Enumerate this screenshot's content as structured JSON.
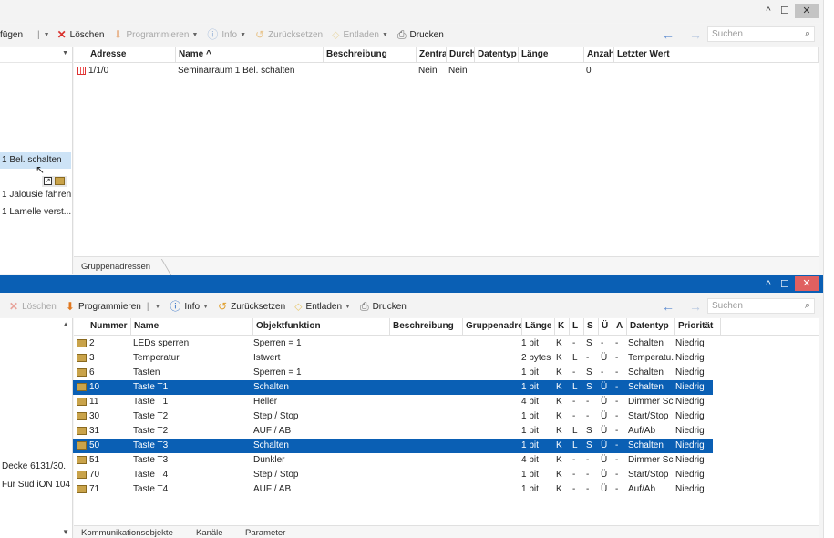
{
  "top": {
    "window_buttons": {
      "minimize": "^",
      "maximize": "☐",
      "close": "✕"
    },
    "toolbar": {
      "insert_label": "fügen",
      "delete_label": "Löschen",
      "program_label": "Programmieren",
      "info_label": "Info",
      "reset_label": "Zurücksetzen",
      "unload_label": "Entladen",
      "print_label": "Drucken",
      "search_placeholder": "Suchen"
    },
    "tree": [
      {
        "label": "1 Bel. schalten",
        "selected": true
      },
      {
        "label": "1 Jalousie fahren",
        "selected": false
      },
      {
        "label": "1 Lamelle verst...",
        "selected": false
      }
    ],
    "columns": [
      "Adresse",
      "Name ^",
      "Beschreibung",
      "Zentra",
      "Durch",
      "Datentyp",
      "Länge",
      "Anzah",
      "Letzter Wert"
    ],
    "rows": [
      {
        "adresse": "1/1/0",
        "name": "Seminarraum 1 Bel. schalten",
        "beschreibung": "",
        "zentral": "Nein",
        "durch": "Nein",
        "datentyp": "",
        "laenge": "",
        "anzahl": "0",
        "letzter": ""
      }
    ],
    "tab": "Gruppenadressen"
  },
  "bottom": {
    "window_buttons": {
      "minimize": "^",
      "maximize": "☐",
      "close": "✕"
    },
    "toolbar": {
      "delete_label": "Löschen",
      "program_label": "Programmieren",
      "info_label": "Info",
      "reset_label": "Zurücksetzen",
      "unload_label": "Entladen",
      "print_label": "Drucken",
      "search_placeholder": "Suchen"
    },
    "tree": [
      {
        "label": "Decke 6131/30."
      },
      {
        "label": "Für Süd iON 104"
      }
    ],
    "columns": [
      "Nummer",
      "Name",
      "Objektfunktion",
      "Beschreibung",
      "Gruppenadres",
      "Länge",
      "K",
      "L",
      "S",
      "Ü",
      "A",
      "Datentyp",
      "Priorität"
    ],
    "rows": [
      {
        "nr": "2",
        "name": "LEDs sperren",
        "fn": "Sperren = 1",
        "len": "1 bit",
        "k": "K",
        "l": "-",
        "s": "S",
        "u": "-",
        "a": "-",
        "typ": "Schalten",
        "prio": "Niedrig",
        "sel": false
      },
      {
        "nr": "3",
        "name": "Temperatur",
        "fn": "Istwert",
        "len": "2 bytes",
        "k": "K",
        "l": "L",
        "s": "-",
        "u": "Ü",
        "a": "-",
        "typ": "Temperatu...",
        "prio": "Niedrig",
        "sel": false
      },
      {
        "nr": "6",
        "name": "Tasten",
        "fn": "Sperren = 1",
        "len": "1 bit",
        "k": "K",
        "l": "-",
        "s": "S",
        "u": "-",
        "a": "-",
        "typ": "Schalten",
        "prio": "Niedrig",
        "sel": false
      },
      {
        "nr": "10",
        "name": "Taste T1",
        "fn": "Schalten",
        "len": "1 bit",
        "k": "K",
        "l": "L",
        "s": "S",
        "u": "Ü",
        "a": "-",
        "typ": "Schalten",
        "prio": "Niedrig",
        "sel": true
      },
      {
        "nr": "11",
        "name": "Taste T1",
        "fn": "Heller",
        "len": "4 bit",
        "k": "K",
        "l": "-",
        "s": "-",
        "u": "Ü",
        "a": "-",
        "typ": "Dimmer Sc...",
        "prio": "Niedrig",
        "sel": false
      },
      {
        "nr": "30",
        "name": "Taste T2",
        "fn": "Step / Stop",
        "len": "1 bit",
        "k": "K",
        "l": "-",
        "s": "-",
        "u": "Ü",
        "a": "-",
        "typ": "Start/Stop",
        "prio": "Niedrig",
        "sel": false
      },
      {
        "nr": "31",
        "name": "Taste T2",
        "fn": "AUF / AB",
        "len": "1 bit",
        "k": "K",
        "l": "L",
        "s": "S",
        "u": "Ü",
        "a": "-",
        "typ": "Auf/Ab",
        "prio": "Niedrig",
        "sel": false
      },
      {
        "nr": "50",
        "name": "Taste T3",
        "fn": "Schalten",
        "len": "1 bit",
        "k": "K",
        "l": "L",
        "s": "S",
        "u": "Ü",
        "a": "-",
        "typ": "Schalten",
        "prio": "Niedrig",
        "sel": true
      },
      {
        "nr": "51",
        "name": "Taste T3",
        "fn": "Dunkler",
        "len": "4 bit",
        "k": "K",
        "l": "-",
        "s": "-",
        "u": "Ü",
        "a": "-",
        "typ": "Dimmer Sc...",
        "prio": "Niedrig",
        "sel": false
      },
      {
        "nr": "70",
        "name": "Taste T4",
        "fn": "Step / Stop",
        "len": "1 bit",
        "k": "K",
        "l": "-",
        "s": "-",
        "u": "Ü",
        "a": "-",
        "typ": "Start/Stop",
        "prio": "Niedrig",
        "sel": false
      },
      {
        "nr": "71",
        "name": "Taste T4",
        "fn": "AUF / AB",
        "len": "1 bit",
        "k": "K",
        "l": "-",
        "s": "-",
        "u": "Ü",
        "a": "-",
        "typ": "Auf/Ab",
        "prio": "Niedrig",
        "sel": false
      }
    ],
    "tabs": [
      "Kommunikationsobjekte",
      "Kanäle",
      "Parameter"
    ]
  },
  "colors": {
    "selection": "#0a5fb4",
    "title_bar": "#0a5fb4",
    "delete_red": "#d9302c",
    "program_orange": "#e07820",
    "info_blue": "#2b6cc4"
  },
  "icons": [
    "delete-icon",
    "program-icon",
    "info-icon",
    "reset-icon",
    "unload-icon",
    "print-icon",
    "back-arrow-icon",
    "forward-arrow-icon",
    "search-icon",
    "group-address-icon",
    "com-object-icon",
    "drag-cursor-icon"
  ]
}
